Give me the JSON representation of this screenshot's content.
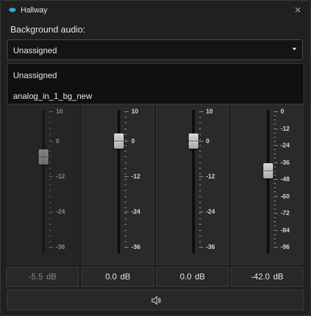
{
  "window": {
    "title": "Hallway",
    "icon": "cloud-icon",
    "close_glyph": "✕"
  },
  "background_audio": {
    "label": "Background audio:",
    "selected": "Unassigned",
    "options": [
      "Unassigned",
      "analog_in_1_bg_new"
    ]
  },
  "faders": [
    {
      "enabled": false,
      "scale": [
        "10",
        "0",
        "-12",
        "-24",
        "-36"
      ],
      "value_db": -5.5,
      "display": "-5.5",
      "unit": "dB"
    },
    {
      "enabled": true,
      "scale": [
        "10",
        "0",
        "-12",
        "-24",
        "-36"
      ],
      "value_db": 0.0,
      "display": "0.0",
      "unit": "dB"
    },
    {
      "enabled": true,
      "scale": [
        "10",
        "0",
        "-12",
        "-24",
        "-36"
      ],
      "value_db": 0.0,
      "display": "0.0",
      "unit": "dB"
    },
    {
      "enabled": true,
      "scale": [
        "0",
        "-12",
        "-24",
        "-36",
        "-48",
        "-60",
        "-72",
        "-84",
        "-96"
      ],
      "value_db": -42.0,
      "display": "-42.0",
      "unit": "dB"
    }
  ],
  "mute_button": {
    "icon": "speaker-icon"
  },
  "colors": {
    "background": "#202020",
    "panel": "#2a2a2a",
    "accent": "#3ea6d8"
  }
}
